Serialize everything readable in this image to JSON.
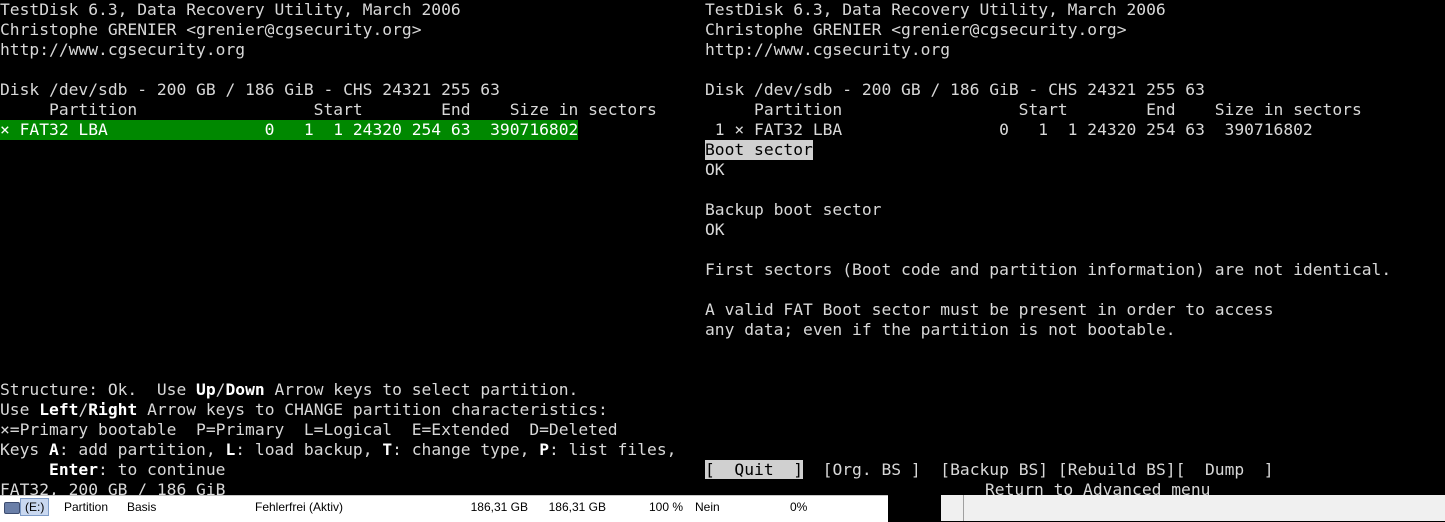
{
  "left": {
    "header1": "TestDisk 6.3, Data Recovery Utility, March 2006",
    "header2": "Christophe GRENIER <grenier@cgsecurity.org>",
    "header3": "http://www.cgsecurity.org",
    "disk": "Disk /dev/sdb - 200 GB / 186 GiB - CHS 24321 255 63",
    "table_header": "     Partition                  Start        End    Size in sectors",
    "partition_row": "× FAT32 LBA                0   1  1 24320 254 63  390716802",
    "help1_a": "Structure: Ok.  Use ",
    "help1_b": "Up",
    "help1_c": "/",
    "help1_d": "Down",
    "help1_e": " Arrow keys to select partition.",
    "help2_a": "Use ",
    "help2_b": "Left",
    "help2_c": "/",
    "help2_d": "Right",
    "help2_e": " Arrow keys to CHANGE partition characteristics:",
    "help3": "×=Primary bootable  P=Primary  L=Logical  E=Extended  D=Deleted",
    "help4_a": "Keys ",
    "help4_b": "A",
    "help4_c": ": add partition, ",
    "help4_d": "L",
    "help4_e": ": load backup, ",
    "help4_f": "T",
    "help4_g": ": change type, ",
    "help4_h": "P",
    "help4_i": ": list files,",
    "help5_indent": "     ",
    "help5_b": "Enter",
    "help5_c": ": to continue",
    "status": "FAT32, 200 GB / 186 GiB"
  },
  "right": {
    "header1": "TestDisk 6.3, Data Recovery Utility, March 2006",
    "header2": "Christophe GRENIER <grenier@cgsecurity.org>",
    "header3": "http://www.cgsecurity.org",
    "disk": "Disk /dev/sdb - 200 GB / 186 GiB - CHS 24321 255 63",
    "table_header": "     Partition                  Start        End    Size in sectors",
    "partition_row": " 1 × FAT32 LBA                0   1  1 24320 254 63  390716802",
    "boot_sector": "Boot sector",
    "boot_ok": "OK",
    "backup_boot": "Backup boot sector",
    "backup_ok": "OK",
    "first_sectors": "First sectors (Boot code and partition information) are not identical.",
    "valid_fat1": "A valid FAT Boot sector must be present in order to access",
    "valid_fat2": "any data; even if the partition is not bootable.",
    "menu": {
      "quit": "[  Quit  ]",
      "org_bs": "[Org. BS ]",
      "backup_bs": "[Backup BS]",
      "rebuild_bs": "[Rebuild BS]",
      "dump": "[  Dump  ]"
    },
    "return_text": "Return to Advanced menu"
  },
  "taskbar": {
    "drive": "(E:)",
    "partition": "Partition",
    "type": "Basis",
    "status": "Fehlerfrei (Aktiv)",
    "capacity": "186,31 GB",
    "free": "186,31 GB",
    "percent": "100 %",
    "fault": "Nein",
    "overhead": "0%"
  },
  "colors": {
    "terminal_bg": "#000000",
    "terminal_text": "#d8d8d8",
    "selection_green": "#008800",
    "selection_grey": "#d0d0d0"
  }
}
